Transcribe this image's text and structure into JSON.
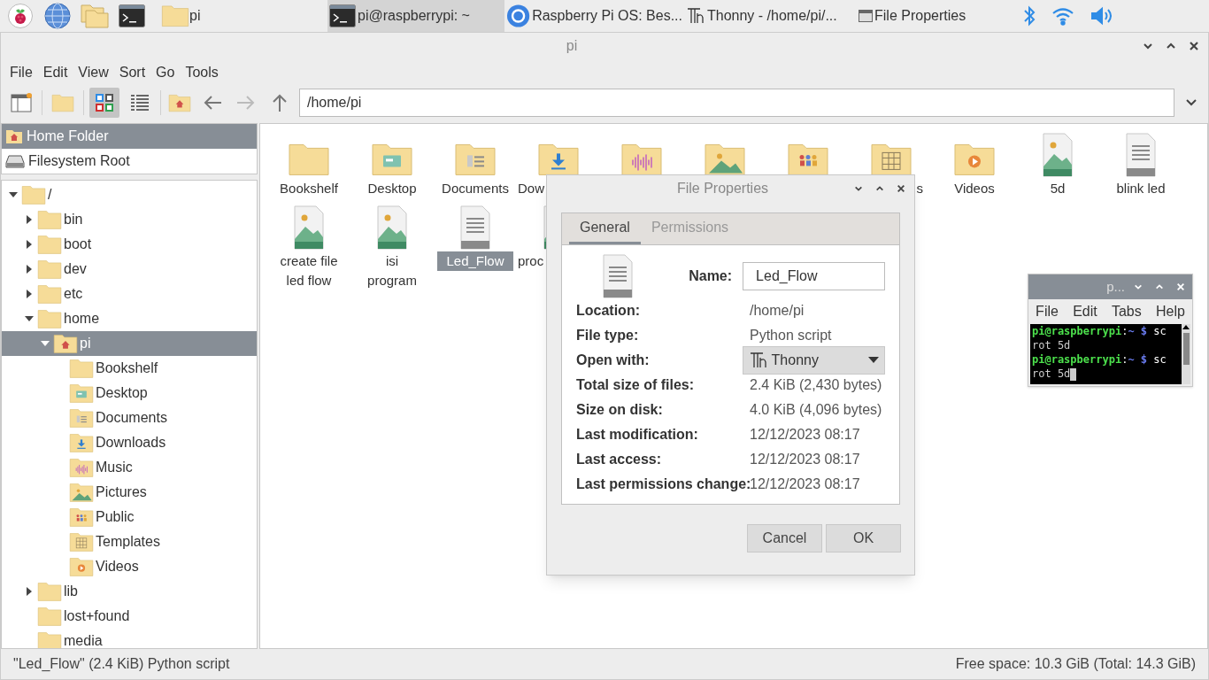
{
  "taskbar": {
    "launchers": [
      {
        "kind": "menu"
      },
      {
        "kind": "browser"
      },
      {
        "kind": "files"
      },
      {
        "kind": "terminal"
      }
    ],
    "launcher_label": "pi",
    "tasks": [
      {
        "kind": "terminal",
        "label": "pi@raspberrypi: ~",
        "selected": true
      },
      {
        "kind": "browser",
        "label": "Raspberry Pi OS: Bes...",
        "selected": false
      },
      {
        "kind": "thonny",
        "label": "Thonny  -  /home/pi/...",
        "selected": false
      },
      {
        "kind": "dialog",
        "label": "File Properties",
        "selected": false
      }
    ],
    "tray": [
      {
        "kind": "bluetooth"
      },
      {
        "kind": "wifi"
      },
      {
        "kind": "volume"
      }
    ]
  },
  "window": {
    "title": "pi",
    "menu": [
      "File",
      "Edit",
      "View",
      "Sort",
      "Go",
      "Tools"
    ],
    "toolbar": {
      "view_buttons": [
        {
          "kind": "icons",
          "selected": true
        },
        {
          "kind": "list",
          "selected": false
        }
      ],
      "nav": [
        {
          "kind": "back",
          "disabled": false
        },
        {
          "kind": "forward",
          "disabled": true
        },
        {
          "kind": "up",
          "disabled": false
        }
      ],
      "path": "/home/pi"
    },
    "places": [
      {
        "label": "Home Folder",
        "kind": "home",
        "selected": true
      },
      {
        "label": "Filesystem Root",
        "kind": "drive",
        "selected": false
      }
    ],
    "tree": [
      {
        "label": "/",
        "kind": "folder",
        "expanded": true,
        "selected": false,
        "children": [
          {
            "label": "bin",
            "kind": "folder",
            "expanded": false,
            "selected": false
          },
          {
            "label": "boot",
            "kind": "folder",
            "expanded": false,
            "selected": false
          },
          {
            "label": "dev",
            "kind": "folder",
            "expanded": false,
            "selected": false
          },
          {
            "label": "etc",
            "kind": "folder",
            "expanded": false,
            "selected": false
          },
          {
            "label": "home",
            "kind": "folder",
            "expanded": true,
            "selected": false,
            "children": [
              {
                "label": "pi",
                "kind": "home",
                "expanded": true,
                "selected": true,
                "children": [
                  {
                    "label": "Bookshelf",
                    "kind": "folder",
                    "selected": false
                  },
                  {
                    "label": "Desktop",
                    "kind": "desktop",
                    "selected": false
                  },
                  {
                    "label": "Documents",
                    "kind": "documents",
                    "selected": false
                  },
                  {
                    "label": "Downloads",
                    "kind": "downloads",
                    "selected": false
                  },
                  {
                    "label": "Music",
                    "kind": "music",
                    "selected": false
                  },
                  {
                    "label": "Pictures",
                    "kind": "pictures",
                    "selected": false
                  },
                  {
                    "label": "Public",
                    "kind": "public",
                    "selected": false
                  },
                  {
                    "label": "Templates",
                    "kind": "templates",
                    "selected": false
                  },
                  {
                    "label": "Videos",
                    "kind": "videos",
                    "selected": false
                  }
                ]
              }
            ]
          },
          {
            "label": "lib",
            "kind": "folder",
            "expanded": false,
            "selected": false
          },
          {
            "label": "lost+found",
            "kind": "folder",
            "selected": false
          },
          {
            "label": "media",
            "kind": "folder",
            "selected": false
          }
        ]
      }
    ],
    "files": [
      [
        {
          "label": "Bookshelf",
          "kind": "folder",
          "selected": false
        },
        {
          "label": "Desktop",
          "kind": "desktop",
          "selected": false
        },
        {
          "label": "Documents",
          "kind": "documents",
          "selected": false
        },
        {
          "label": "Dow",
          "kind": "downloads",
          "cut_right": true,
          "selected": false
        },
        {
          "kind": "music",
          "selected": false
        },
        {
          "kind": "pictures",
          "selected": false
        },
        {
          "kind": "public",
          "selected": false
        },
        {
          "label": "s",
          "kind": "templates",
          "cut_left": true,
          "selected": false
        },
        {
          "label": "Videos",
          "kind": "videos",
          "selected": false
        },
        {
          "label": "5d",
          "kind": "image",
          "selected": false
        },
        {
          "label": "blink led",
          "kind": "text",
          "selected": false
        }
      ],
      [
        {
          "label": "create file led flow",
          "kind": "image",
          "selected": false
        },
        {
          "label": "isi program",
          "kind": "image",
          "selected": false
        },
        {
          "label": "Led_Flow",
          "kind": "text",
          "selected": true
        },
        {
          "label": "proc",
          "kind": "image",
          "cut_right": true,
          "selected": false
        }
      ]
    ],
    "status_left": "\"Led_Flow\" (2.4 KiB) Python script",
    "status_right": "Free space: 10.3 GiB (Total: 14.3 GiB)"
  },
  "dialog": {
    "title": "File Properties",
    "tabs": [
      {
        "label": "General",
        "selected": true
      },
      {
        "label": "Permissions",
        "selected": false
      }
    ],
    "name_label": "Name:",
    "name_value": "Led_Flow",
    "rows": [
      {
        "label": "Location:",
        "value": "/home/pi",
        "kind": "text"
      },
      {
        "label": "File type:",
        "value": "Python script",
        "kind": "text"
      },
      {
        "label": "Open with:",
        "value": "Thonny",
        "kind": "dropdown"
      },
      {
        "label": "Total size of files:",
        "value": "2.4 KiB (2,430 bytes)",
        "kind": "text"
      },
      {
        "label": "Size on disk:",
        "value": "4.0 KiB (4,096 bytes)",
        "kind": "text"
      },
      {
        "label": "Last modification:",
        "value": "12/12/2023 08:17",
        "kind": "text"
      },
      {
        "label": "Last access:",
        "value": "12/12/2023 08:17",
        "kind": "text"
      },
      {
        "label": "Last permissions change:",
        "value": "12/12/2023 08:17",
        "kind": "text"
      }
    ],
    "buttons": [
      "Cancel",
      "OK"
    ]
  },
  "terminal": {
    "title": "p...",
    "menu": [
      "File",
      "Edit",
      "Tabs",
      "Help"
    ],
    "lines": [
      {
        "kind": "prompt",
        "user": "pi@raspberrypi",
        "sep": ":",
        "path": "~",
        "symbol": "$",
        "command": "sc",
        "cursor": false
      },
      {
        "kind": "output",
        "text": "rot 5d",
        "cursor": false
      },
      {
        "kind": "prompt",
        "user": "pi@raspberrypi",
        "sep": ":",
        "path": "~",
        "symbol": "$",
        "command": "sc",
        "cursor": false
      },
      {
        "kind": "output",
        "text": "rot 5d",
        "cursor": true
      }
    ]
  }
}
